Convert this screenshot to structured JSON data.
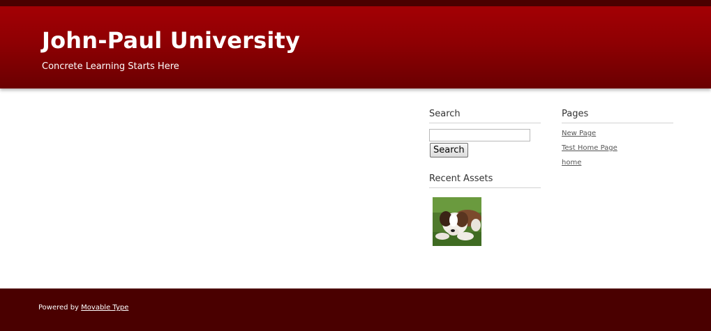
{
  "header": {
    "title": "John-Paul University",
    "tagline": "Concrete Learning Starts Here"
  },
  "sidebar": {
    "search": {
      "title": "Search",
      "input_value": "",
      "button_label": "Search"
    },
    "recent_assets": {
      "title": "Recent Assets",
      "items": [
        {
          "icon": "dog-photo-thumbnail"
        }
      ]
    },
    "pages": {
      "title": "Pages",
      "items": [
        {
          "label": "New Page"
        },
        {
          "label": "Test Home Page"
        },
        {
          "label": "home"
        }
      ]
    }
  },
  "footer": {
    "powered_by": "Powered by",
    "link_label": "Movable Type"
  },
  "colors": {
    "header_top": "#a30004",
    "header_bottom": "#6a0001",
    "footer_bg": "#4a0000"
  }
}
